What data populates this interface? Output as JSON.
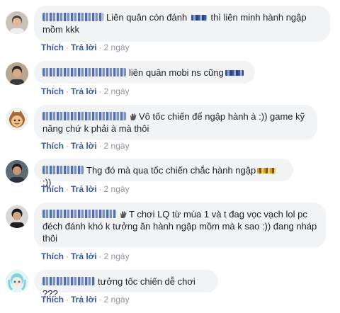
{
  "actions": {
    "like": "Thích",
    "reply": "Trả lời",
    "separator": "·"
  },
  "comments": [
    {
      "text_before": "Liên quân còn đánh",
      "text_after": "thì liên minh hành ngập mồm kkk",
      "time": "2 ngày",
      "avatar_icon": "photo-avatar"
    },
    {
      "text_before": "liên quân mobi ns cũng",
      "text_after": "",
      "time": "2 ngày",
      "avatar_icon": "photo-avatar"
    },
    {
      "text_before": "Vô tốc chiến để ngập hành à :)) game kỹ năng chứ k phải à mà thôi",
      "text_after": "",
      "time": "2 ngày",
      "avatar_icon": "cartoon-avatar"
    },
    {
      "text_before": "Thg đó mà qua tốc chiến chắc hành ngập",
      "text_after": ":))",
      "time": "2 ngày",
      "avatar_icon": "photo-avatar"
    },
    {
      "text_before": "T chơi LQ từ mùa 1 và t đag vọc vạch lol pc đéch đánh khó k tưởng ăn hành ngập mồm mà k sao :)) đang nháp thôi",
      "text_after": "",
      "time": "2 ngày",
      "avatar_icon": "photo-avatar"
    },
    {
      "text_before": "tưởng tốc chiến dễ chơi ???",
      "text_after": "",
      "time": "2 ngày",
      "avatar_icon": "anime-avatar"
    }
  ],
  "colors": {
    "bubble": "#f2f3f5",
    "link": "#385898",
    "muted": "#90949c",
    "text": "#1c1e21"
  }
}
